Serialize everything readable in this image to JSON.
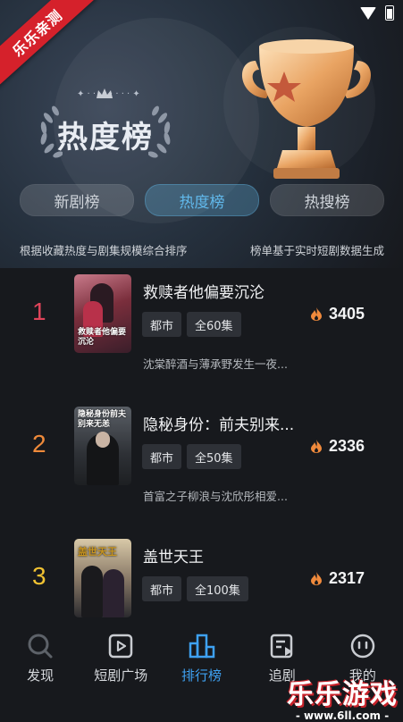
{
  "watermark_badge": "乐乐亲测",
  "header": {
    "title": "热度榜"
  },
  "tabs": [
    {
      "label": "新剧榜",
      "active": false
    },
    {
      "label": "热度榜",
      "active": true
    },
    {
      "label": "热搜榜",
      "active": false
    }
  ],
  "subtitles": {
    "left": "根据收藏热度与剧集规模综合排序",
    "right": "榜单基于实时短剧数据生成"
  },
  "ranking": [
    {
      "rank": "1",
      "rank_color": "#e0445a",
      "title": "救赎者他偏要沉沦",
      "tags": [
        "都市",
        "全60集"
      ],
      "desc": "沈棠醉酒与薄承野发生一夜...",
      "heat": "3405",
      "cover_text": "救赎者他偏要沉沦"
    },
    {
      "rank": "2",
      "rank_color": "#ef8a3a",
      "title": "隐秘身份：前夫别来...",
      "tags": [
        "都市",
        "全50集"
      ],
      "desc": "首富之子柳浪与沈欣彤相爱...",
      "heat": "2336",
      "cover_text": "隐秘身份前夫别来无恙"
    },
    {
      "rank": "3",
      "rank_color": "#f1c232",
      "title": "盖世天王",
      "tags": [
        "都市",
        "全100集"
      ],
      "desc": "",
      "heat": "2317",
      "cover_text": "盖世天王"
    }
  ],
  "bottom_nav": [
    {
      "label": "发现",
      "icon": "search-icon",
      "active": false
    },
    {
      "label": "短剧广场",
      "icon": "play-square-icon",
      "active": false
    },
    {
      "label": "排行榜",
      "icon": "ranking-icon",
      "active": true
    },
    {
      "label": "追剧",
      "icon": "follow-icon",
      "active": false
    },
    {
      "label": "我的",
      "icon": "profile-icon",
      "active": false
    }
  ],
  "site_watermark": {
    "name": "乐乐游戏",
    "url": "- www.6ll.com -"
  },
  "colors": {
    "accent": "#3ea1f2",
    "tab_active_text": "#61b9ec",
    "flame": "#f08a3c"
  }
}
